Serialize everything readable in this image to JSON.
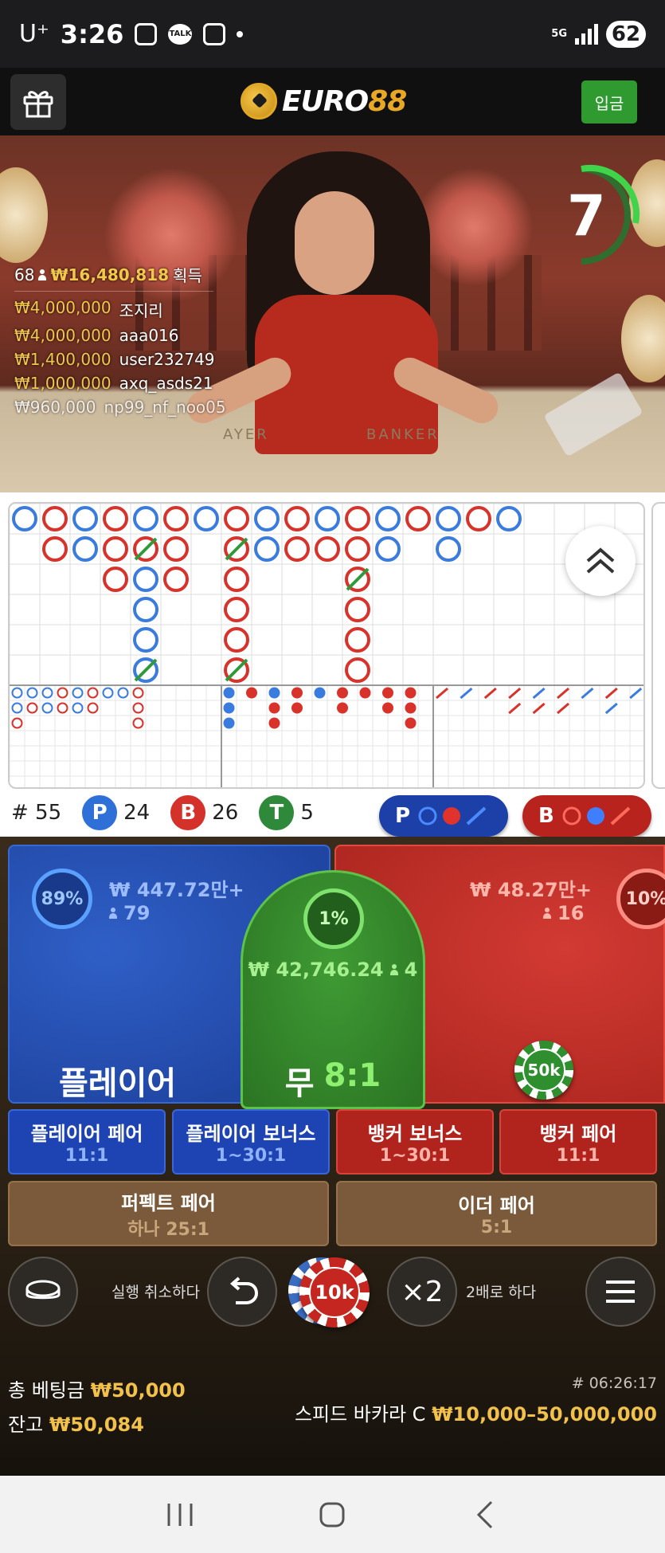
{
  "status_bar": {
    "carrier": "U⁺",
    "time": "3:26",
    "talk": "TALK",
    "network": "5G",
    "battery": "62"
  },
  "header": {
    "logo_part1": "EURO",
    "logo_part2": "88",
    "deposit_label": "입금"
  },
  "video": {
    "countdown": "7",
    "winners_count": "68",
    "winners_total": "₩16,480,818",
    "winners_suffix": "획득",
    "winners": [
      {
        "amount": "₩4,000,000",
        "name": "조지리"
      },
      {
        "amount": "₩4,000,000",
        "name": "aaa016"
      },
      {
        "amount": "₩1,400,000",
        "name": "user232749"
      },
      {
        "amount": "₩1,000,000",
        "name": "axq_asds21"
      },
      {
        "amount": "₩960,000",
        "name": "np99_nf_noo05"
      }
    ],
    "table_text_player": "AYER",
    "table_text_banker": "BANKER"
  },
  "roadmap": {
    "colors": {
      "player": "#3a7be0",
      "banker": "#d8322b",
      "tie": "#2e9a3a"
    },
    "big_road": [
      [
        "P"
      ],
      [
        "B",
        "B"
      ],
      [
        "P",
        "P"
      ],
      [
        "B",
        "B",
        "B"
      ],
      [
        "P",
        "BT",
        "P",
        "P",
        "P",
        "PT"
      ],
      [
        "B",
        "B",
        "B"
      ],
      [
        "P"
      ],
      [
        "B",
        "BT",
        "B",
        "B",
        "B",
        "BT"
      ],
      [
        "P",
        "P"
      ],
      [
        "B",
        "B"
      ],
      [
        "P",
        "B"
      ],
      [
        "B",
        "B",
        "BT",
        "B",
        "B",
        "B"
      ],
      [
        "P",
        "P"
      ],
      [
        "B"
      ],
      [
        "P",
        "P"
      ],
      [
        "B"
      ],
      [
        "P"
      ]
    ]
  },
  "stats": {
    "round_label": "# 55",
    "player_letter": "P",
    "player_count": "24",
    "banker_letter": "B",
    "banker_count": "26",
    "tie_letter": "T",
    "tie_count": "5",
    "player_ask": "P",
    "banker_ask": "B"
  },
  "betting": {
    "player": {
      "pct": "89%",
      "amount": "₩ 447.72만+",
      "players": "79",
      "label": "플레이어"
    },
    "tie": {
      "pct": "1%",
      "amount": "₩ 42,746.24",
      "players": "4",
      "label": "무",
      "odds": "8:1"
    },
    "banker": {
      "pct": "10%",
      "amount": "₩ 48.27만+",
      "players": "16"
    },
    "banker_chip": "50k",
    "side_bets": [
      {
        "title": "플레이어 페어",
        "odds": "11:1"
      },
      {
        "title": "플레이어 보너스",
        "odds": "1~30:1"
      },
      {
        "title": "뱅커 보너스",
        "odds": "1~30:1"
      },
      {
        "title": "뱅커 페어",
        "odds": "11:1"
      }
    ],
    "perfect_pair": {
      "title": "퍼펙트 페어",
      "odds": "하나 25:1"
    },
    "either_pair": {
      "title": "이더 페어",
      "odds": "5:1"
    }
  },
  "controls": {
    "undo_label": "실행 취소하다",
    "chip": "10k",
    "double_symbol": "×2",
    "double_label": "2배로 하다"
  },
  "footer": {
    "total_bet_label": "총 베팅금",
    "total_bet": "₩50,000",
    "balance_label": "잔고",
    "balance": "₩50,084",
    "round_id": "# 06:26:17",
    "table_name": "스피드 바카라 C",
    "limits": "₩10,000–50,000,000"
  }
}
